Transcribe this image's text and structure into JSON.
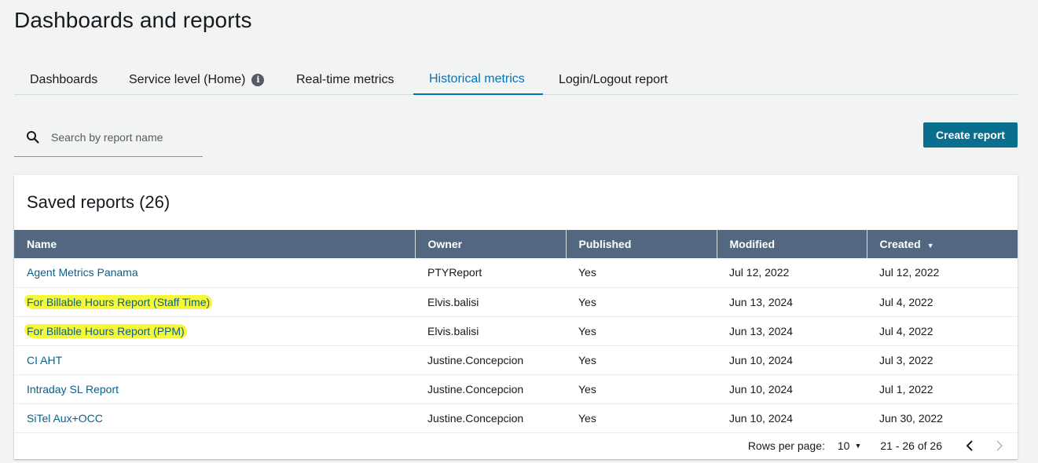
{
  "page": {
    "title": "Dashboards and reports"
  },
  "tabs": [
    {
      "label": "Dashboards",
      "active": false
    },
    {
      "label": "Service level (Home)",
      "active": false,
      "icon": "info-icon"
    },
    {
      "label": "Real-time metrics",
      "active": false
    },
    {
      "label": "Historical metrics",
      "active": true
    },
    {
      "label": "Login/Logout report",
      "active": false
    }
  ],
  "search": {
    "placeholder": "Search by report name",
    "value": ""
  },
  "toolbar": {
    "create_label": "Create report"
  },
  "saved": {
    "title": "Saved reports (26)",
    "columns": [
      "Name",
      "Owner",
      "Published",
      "Modified",
      "Created"
    ],
    "sort_column": "Created",
    "rows": [
      {
        "name": "Agent Metrics Panama",
        "owner": "PTYReport",
        "published": "Yes",
        "modified": "Jul 12, 2022",
        "created": "Jul 12, 2022",
        "highlight": false
      },
      {
        "name": "For Billable Hours Report (Staff Time)",
        "owner": "Elvis.balisi",
        "published": "Yes",
        "modified": "Jun 13, 2024",
        "created": "Jul 4, 2022",
        "highlight": true
      },
      {
        "name": "For Billable Hours Report (PPM)",
        "owner": "Elvis.balisi",
        "published": "Yes",
        "modified": "Jun 13, 2024",
        "created": "Jul 4, 2022",
        "highlight": true
      },
      {
        "name": "CI AHT",
        "owner": "Justine.Concepcion",
        "published": "Yes",
        "modified": "Jun 10, 2024",
        "created": "Jul 3, 2022",
        "highlight": false
      },
      {
        "name": "Intraday SL Report",
        "owner": "Justine.Concepcion",
        "published": "Yes",
        "modified": "Jun 10, 2024",
        "created": "Jul 1, 2022",
        "highlight": false
      },
      {
        "name": "SiTel Aux+OCC",
        "owner": "Justine.Concepcion",
        "published": "Yes",
        "modified": "Jun 10, 2024",
        "created": "Jun 30, 2022",
        "highlight": false
      }
    ]
  },
  "pagination": {
    "rows_label": "Rows per page:",
    "rows_value": "10",
    "range": "21 - 26 of 26"
  },
  "colors": {
    "accent": "#0073bb",
    "header_bg": "#536880",
    "button": "#0a6e8f",
    "highlight": "#f7f73a"
  }
}
